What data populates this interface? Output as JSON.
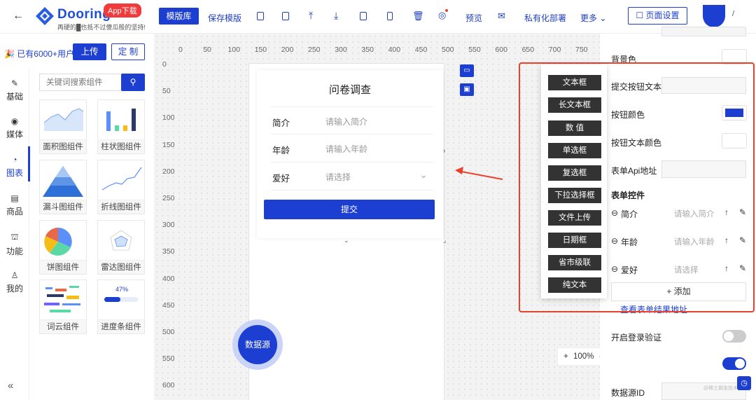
{
  "header": {
    "back_icon": "arrow-left",
    "logo_text": "Dooring",
    "app_badge": "App下载",
    "slogan": "再硬的█也抵不过傻瓜般的坚持!",
    "template_button": "模版库",
    "save_template": "保存模版",
    "preview": "预览",
    "private_deploy": "私有化部署",
    "more": "更多",
    "page_settings": "页面设置"
  },
  "left": {
    "user_count": "已有6000+用户",
    "upload": "上传",
    "customize": "定 制",
    "search_placeholder": "关键词搜索组件",
    "collapse": "«",
    "categories": [
      {
        "icon": "brush-icon",
        "glyph": "✎",
        "label": "基础"
      },
      {
        "icon": "play-icon",
        "glyph": "◉",
        "label": "媒体"
      },
      {
        "icon": "chart-icon",
        "glyph": "◔",
        "label": "图表"
      },
      {
        "icon": "shop-icon",
        "glyph": "▤",
        "label": "商品"
      },
      {
        "icon": "function-icon",
        "glyph": "⛫",
        "label": "功能"
      },
      {
        "icon": "user-icon",
        "glyph": "♙",
        "label": "我的"
      }
    ],
    "components": [
      "面积图组件",
      "柱状图组件",
      "漏斗图组件",
      "折线图组件",
      "饼图组件",
      "雷达图组件",
      "词云组件",
      "进度条组件"
    ],
    "progress_value": "47%"
  },
  "canvas": {
    "ruler_x": [
      "0",
      "50",
      "100",
      "150",
      "200",
      "250",
      "300",
      "350",
      "400",
      "450",
      "500",
      "550",
      "600",
      "650",
      "700",
      "750"
    ],
    "ruler_y": [
      "0",
      "50",
      "100",
      "150",
      "200",
      "250",
      "300",
      "350",
      "400",
      "450",
      "500",
      "550",
      "600"
    ],
    "form": {
      "title": "问卷调查",
      "rows": [
        {
          "label": "简介",
          "placeholder": "请输入简介"
        },
        {
          "label": "年龄",
          "placeholder": "请输入年龄"
        },
        {
          "label": "爱好",
          "placeholder": "请选择"
        }
      ],
      "submit": "提交"
    },
    "datasource_button": "数据源",
    "zoom": "100%",
    "zoom_plus": "+",
    "zoom_minus": "-"
  },
  "controls": [
    "文本框",
    "长文本框",
    "数 值",
    "单选框",
    "复选框",
    "下拉选择框",
    "文件上传",
    "日期框",
    "省市级联",
    "纯文本"
  ],
  "right": {
    "bg_color": "背景色",
    "submit_text": "提交按钮文本",
    "button_color": "按钮颜色",
    "button_text_color": "按钮文本颜色",
    "api_url": "表单Api地址",
    "form_controls": "表单控件",
    "items": [
      {
        "label": "简介",
        "placeholder": "请输入简介"
      },
      {
        "label": "年龄",
        "placeholder": "请输入年龄"
      },
      {
        "label": "爱好",
        "placeholder": "请选择"
      }
    ],
    "add": "+ 添加",
    "view_results": "查看表单结果地址",
    "login_verify": "开启登录验证",
    "datasource_id": "数据源ID",
    "watermark": "@稀土掘金技术社区",
    "button_color_value": "#1d3fd1",
    "login_verify_on": false,
    "second_toggle_on": true
  },
  "colors": {
    "accent": "#1d3fd1",
    "highlight": "#e8412c"
  }
}
